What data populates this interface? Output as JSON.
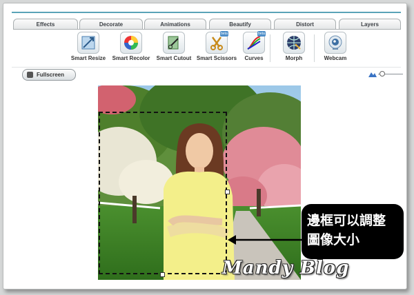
{
  "tabs": [
    {
      "label": "Effects"
    },
    {
      "label": "Decorate"
    },
    {
      "label": "Animations"
    },
    {
      "label": "Beautify"
    },
    {
      "label": "Distort"
    },
    {
      "label": "Layers"
    }
  ],
  "tools": [
    {
      "label": "Smart Resize",
      "icon": "smart-resize-icon",
      "beta": ""
    },
    {
      "label": "Smart Recolor",
      "icon": "color-wheel-icon",
      "beta": ""
    },
    {
      "label": "Smart Cutout",
      "icon": "scissors-cut-icon",
      "beta": ""
    },
    {
      "label": "Smart Scissors",
      "icon": "scissors-icon",
      "beta": "beta"
    },
    {
      "label": "Curves",
      "icon": "curves-icon",
      "beta": "beta"
    },
    {
      "label": "Morph",
      "icon": "morph-globe-icon",
      "beta": ""
    },
    {
      "label": "Webcam",
      "icon": "webcam-icon",
      "beta": ""
    }
  ],
  "toolbar": {
    "fullscreen_label": "Fullscreen"
  },
  "annotation": {
    "line1": "邊框可以調整",
    "line2": "圖像大小"
  },
  "watermark": "Mandy Blog",
  "colors": {
    "accent": "#5aa3b7",
    "callout_bg": "#000000"
  }
}
